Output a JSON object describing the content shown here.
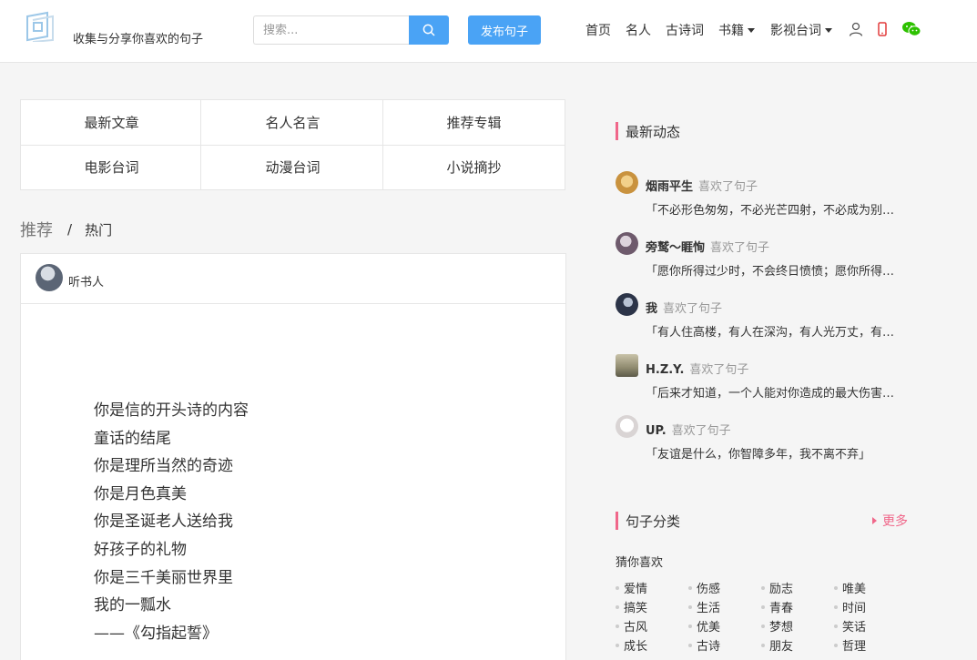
{
  "header": {
    "slogan": "收集与分享你喜欢的句子",
    "search_placeholder": "搜索...",
    "publish_label": "发布句子",
    "nav": [
      {
        "label": "首页"
      },
      {
        "label": "名人"
      },
      {
        "label": "古诗词"
      },
      {
        "label": "书籍"
      },
      {
        "label": "影视台词"
      }
    ],
    "icons": [
      "user-icon",
      "phone-icon",
      "wechat-icon"
    ],
    "accent_color": "#4aa3f5"
  },
  "categories": [
    "最新文章",
    "名人名言",
    "推荐专辑",
    "电影台词",
    "动漫台词",
    "小说摘抄"
  ],
  "tabs": {
    "recommend": "推荐",
    "separator": "/",
    "hot": "热门"
  },
  "card": {
    "author": "听书人",
    "lines": [
      "你是信的开头诗的内容",
      "童话的结尾",
      "你是理所当然的奇迹",
      "你是月色真美",
      "你是圣诞老人送给我",
      "好孩子的礼物",
      "你是三千美丽世界里",
      "我的一瓢水",
      "——《勾指起誓》"
    ]
  },
  "feed": {
    "title": "最新动态",
    "items": [
      {
        "user": "烟雨平生",
        "action": "喜欢了句子",
        "quote": "「不必形色匆匆，不必光芒四射，不必成为别人眼中的谁」"
      },
      {
        "user": "旁鹫～睚恂",
        "action": "喜欢了句子",
        "quote": "「愿你所得过少时，不会终日愤愤；愿你所得过多时，不必终日惶恐」"
      },
      {
        "user": "我",
        "action": "喜欢了句子",
        "quote": "「有人住高楼，有人在深沟，有人光万丈，有人一身锈」"
      },
      {
        "user": "H.Z.Y.",
        "action": "喜欢了句子",
        "quote": "「后来才知道，一个人能对你造成的最大伤害，是离开」"
      },
      {
        "user": "UP.",
        "action": "喜欢了句子",
        "quote": "「友谊是什么，你智障多年，我不离不弃」"
      }
    ],
    "accent_color": "#f0678a"
  },
  "classify": {
    "title": "句子分类",
    "more": "更多",
    "guess": "猜你喜欢",
    "tags": [
      "爱情",
      "伤感",
      "励志",
      "唯美",
      "搞笑",
      "生活",
      "青春",
      "时间",
      "古风",
      "优美",
      "梦想",
      "笑话",
      "成长",
      "古诗",
      "朋友",
      "哲理"
    ]
  }
}
